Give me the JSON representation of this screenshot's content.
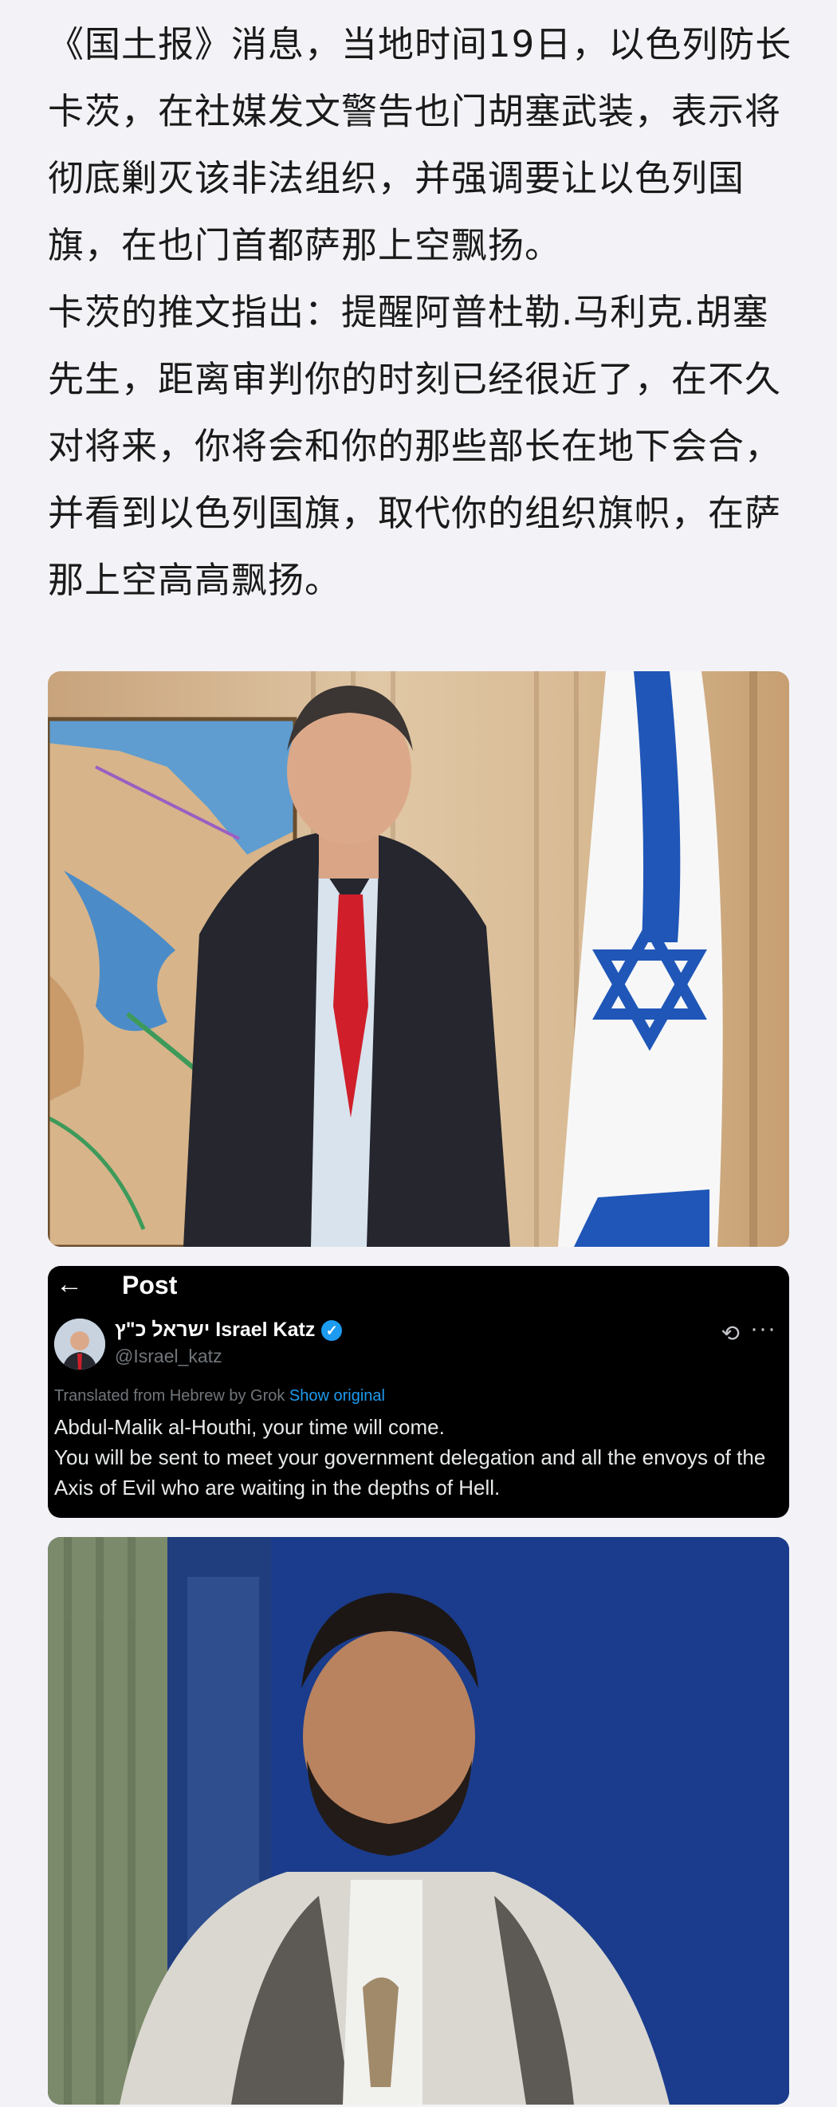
{
  "article": {
    "paragraph1": "《国土报》消息，当地时间19日，以色列防长卡茨，在社媒发文警告也门胡塞武装，表示将彻底剿灭该非法组织，并强调要让以色列国旗，在也门首都萨那上空飘扬。",
    "paragraph2": "卡茨的推文指出：提醒阿普杜勒.马利克.胡塞先生，距离审判你的时刻已经很近了，在不久对将来，你将会和你的那些部长在地下会合，并看到以色列国旗，取代你的组织旗帜，在萨那上空高高飘扬。"
  },
  "tweet": {
    "back_icon": "←",
    "header_title": "Post",
    "display_name": "ישראל כ\"ץ Israel Katz",
    "verified_icon": "✓",
    "handle": "@Israel_katz",
    "grok_icon": "⟲",
    "more_icon": "···",
    "translated_note": "Translated from Hebrew by Grok",
    "show_original": "Show original",
    "line1": "Abdul-Malik al-Houthi, your time will come.",
    "line2": "You will be sent to meet your government delegation and all the envoys of the Axis of Evil who are waiting in the depths of Hell."
  },
  "colors": {
    "page_bg": "#f3f3f7",
    "tweet_bg": "#000000",
    "link_blue": "#1d9bf0",
    "flag_blue": "#1f56b8",
    "tie_red": "#d01f2a"
  }
}
